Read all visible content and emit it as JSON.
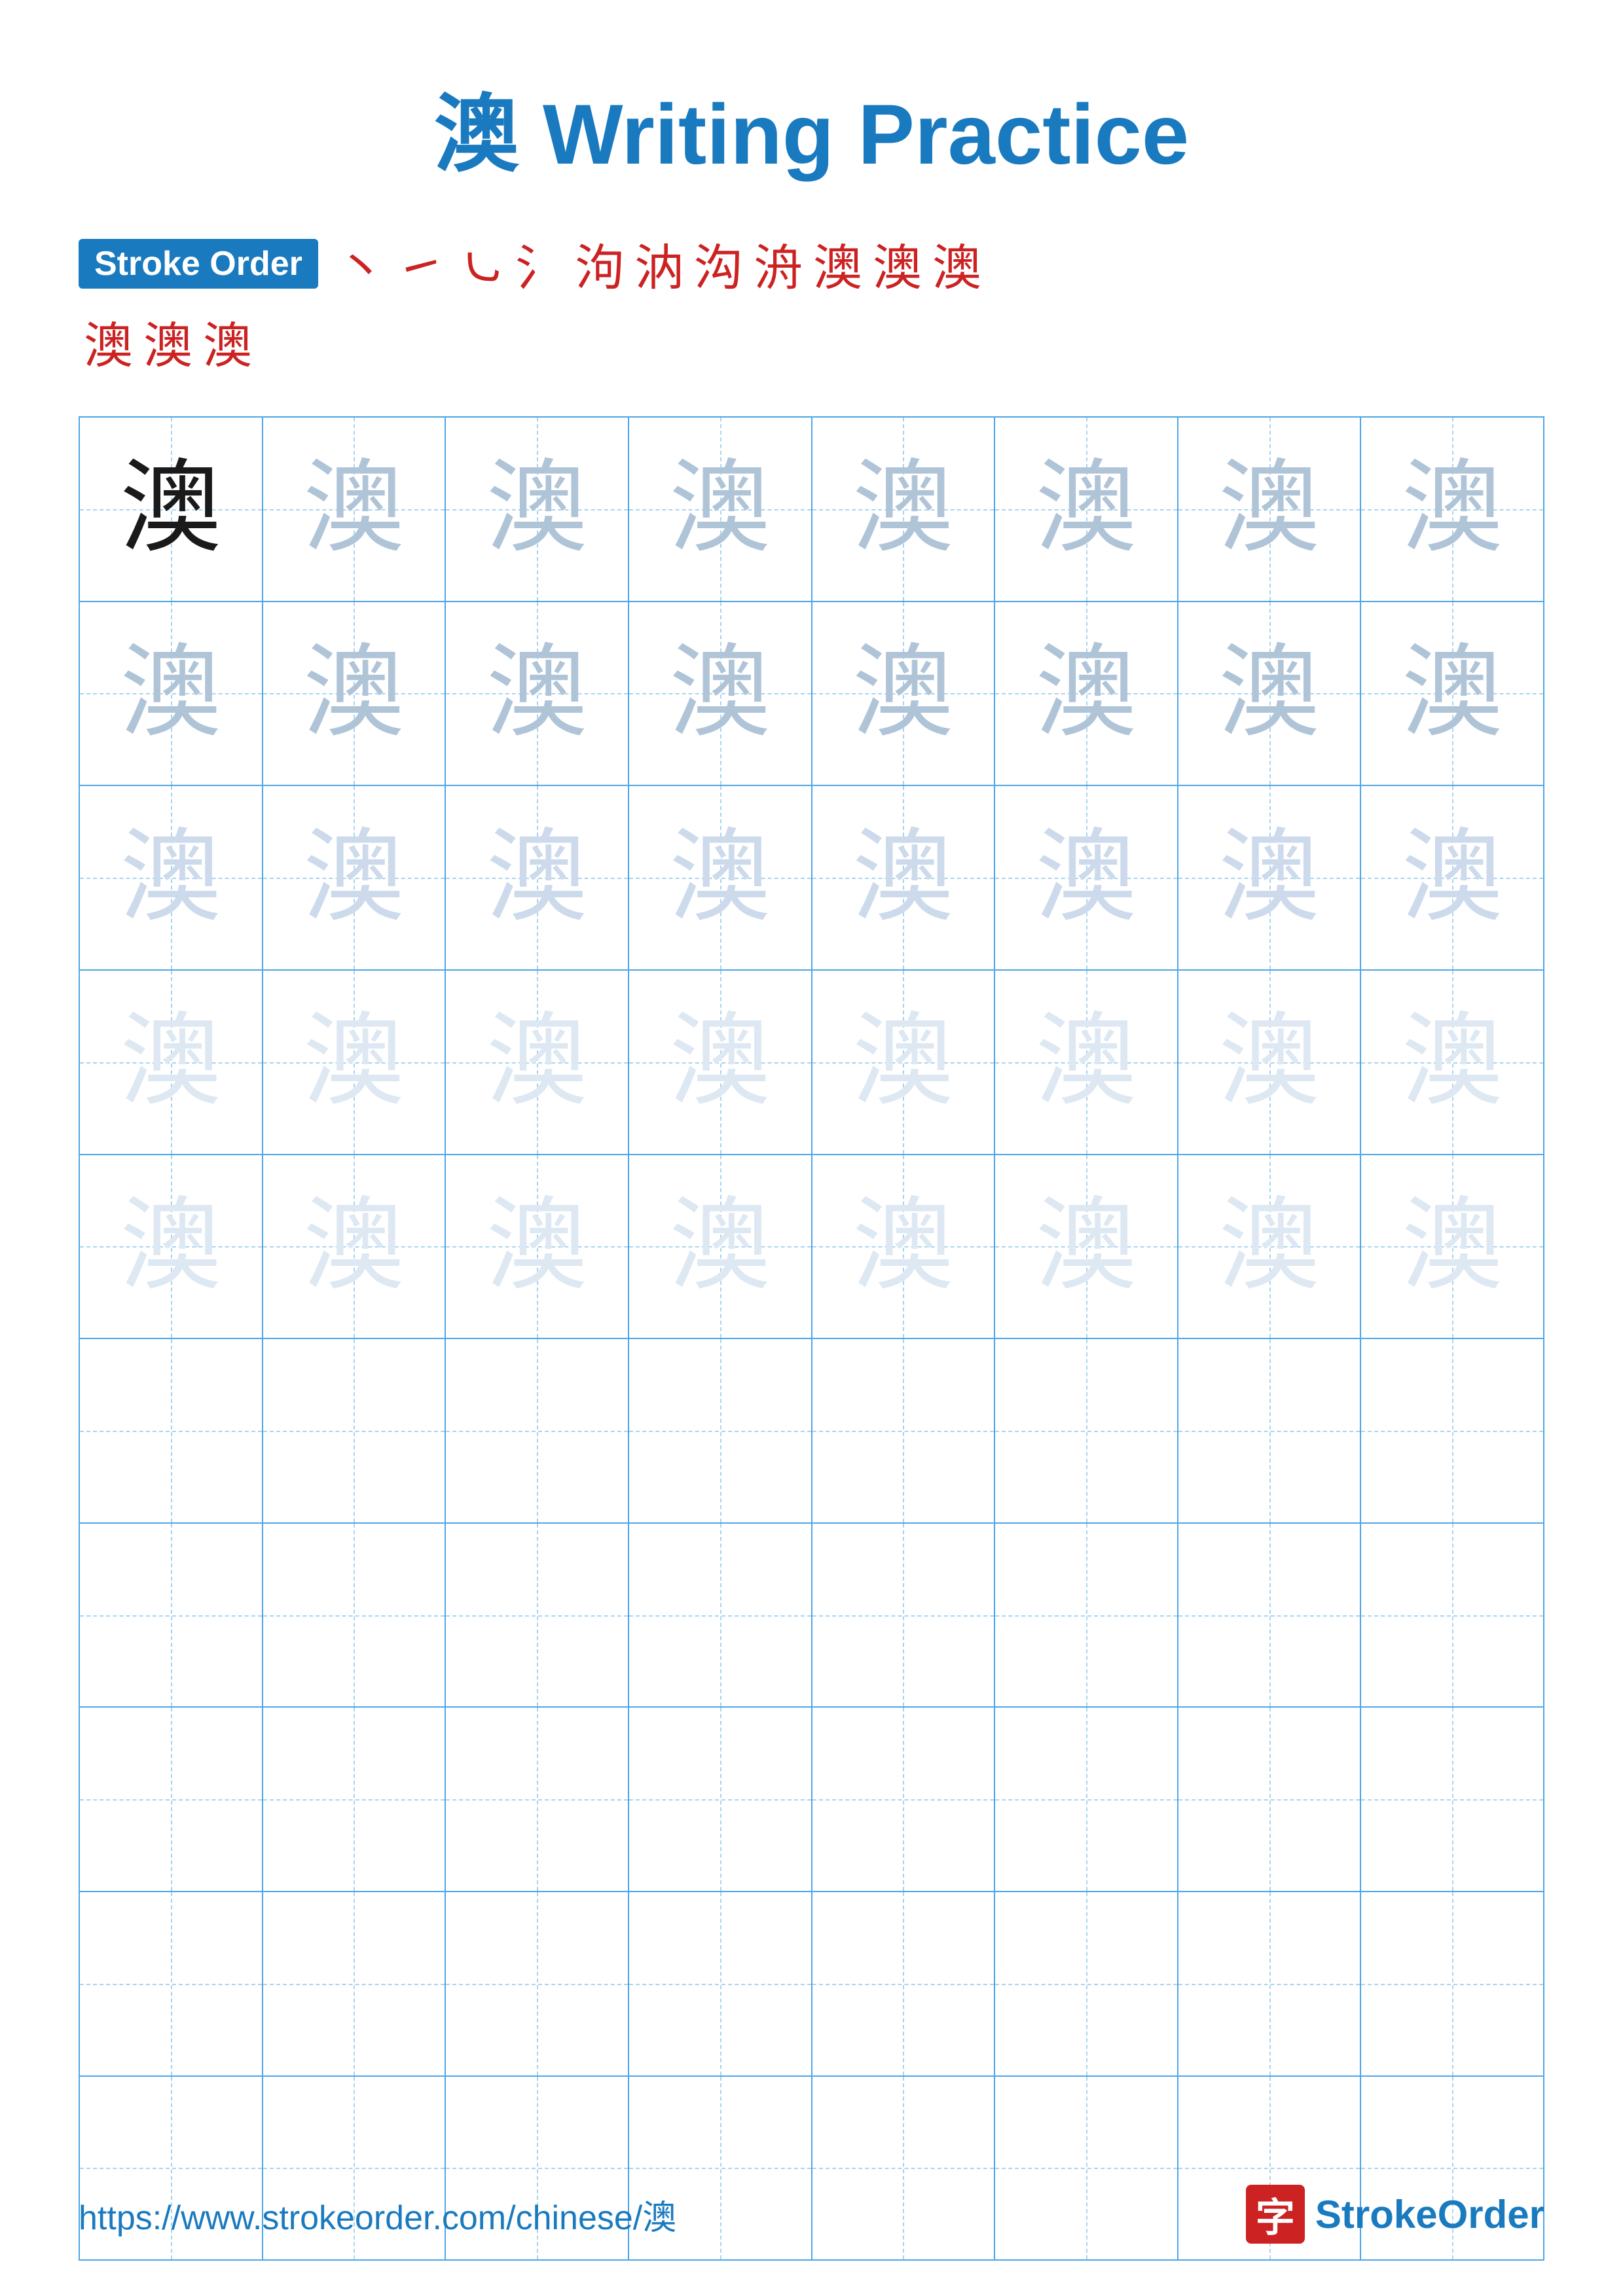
{
  "title": {
    "chinese": "澳",
    "english": " Writing Practice"
  },
  "stroke_order": {
    "badge_label": "Stroke Order",
    "strokes_row1": [
      "丶",
      "㇀",
      "㇃",
      "氵",
      "泃",
      "泃",
      "洀",
      "洀",
      "澳",
      "澳",
      "澳"
    ],
    "strokes_row2": [
      "澳",
      "澳",
      "澳"
    ]
  },
  "grid": {
    "rows": 10,
    "cols": 8,
    "character": "澳",
    "row_shades": [
      [
        "dark",
        "medium",
        "medium",
        "medium",
        "medium",
        "medium",
        "medium",
        "medium"
      ],
      [
        "medium",
        "medium",
        "medium",
        "medium",
        "medium",
        "medium",
        "medium",
        "medium"
      ],
      [
        "light",
        "light",
        "light",
        "light",
        "light",
        "light",
        "light",
        "light"
      ],
      [
        "vlight",
        "vlight",
        "vlight",
        "vlight",
        "vlight",
        "vlight",
        "vlight",
        "vlight"
      ],
      [
        "vlight",
        "vlight",
        "vlight",
        "vlight",
        "vlight",
        "vlight",
        "vlight",
        "vlight"
      ],
      [
        "empty",
        "empty",
        "empty",
        "empty",
        "empty",
        "empty",
        "empty",
        "empty"
      ],
      [
        "empty",
        "empty",
        "empty",
        "empty",
        "empty",
        "empty",
        "empty",
        "empty"
      ],
      [
        "empty",
        "empty",
        "empty",
        "empty",
        "empty",
        "empty",
        "empty",
        "empty"
      ],
      [
        "empty",
        "empty",
        "empty",
        "empty",
        "empty",
        "empty",
        "empty",
        "empty"
      ],
      [
        "empty",
        "empty",
        "empty",
        "empty",
        "empty",
        "empty",
        "empty",
        "empty"
      ]
    ]
  },
  "footer": {
    "url": "https://www.strokeorder.com/chinese/澳",
    "logo_char": "字",
    "logo_text_stroke": "Stroke",
    "logo_text_order": "Order"
  }
}
